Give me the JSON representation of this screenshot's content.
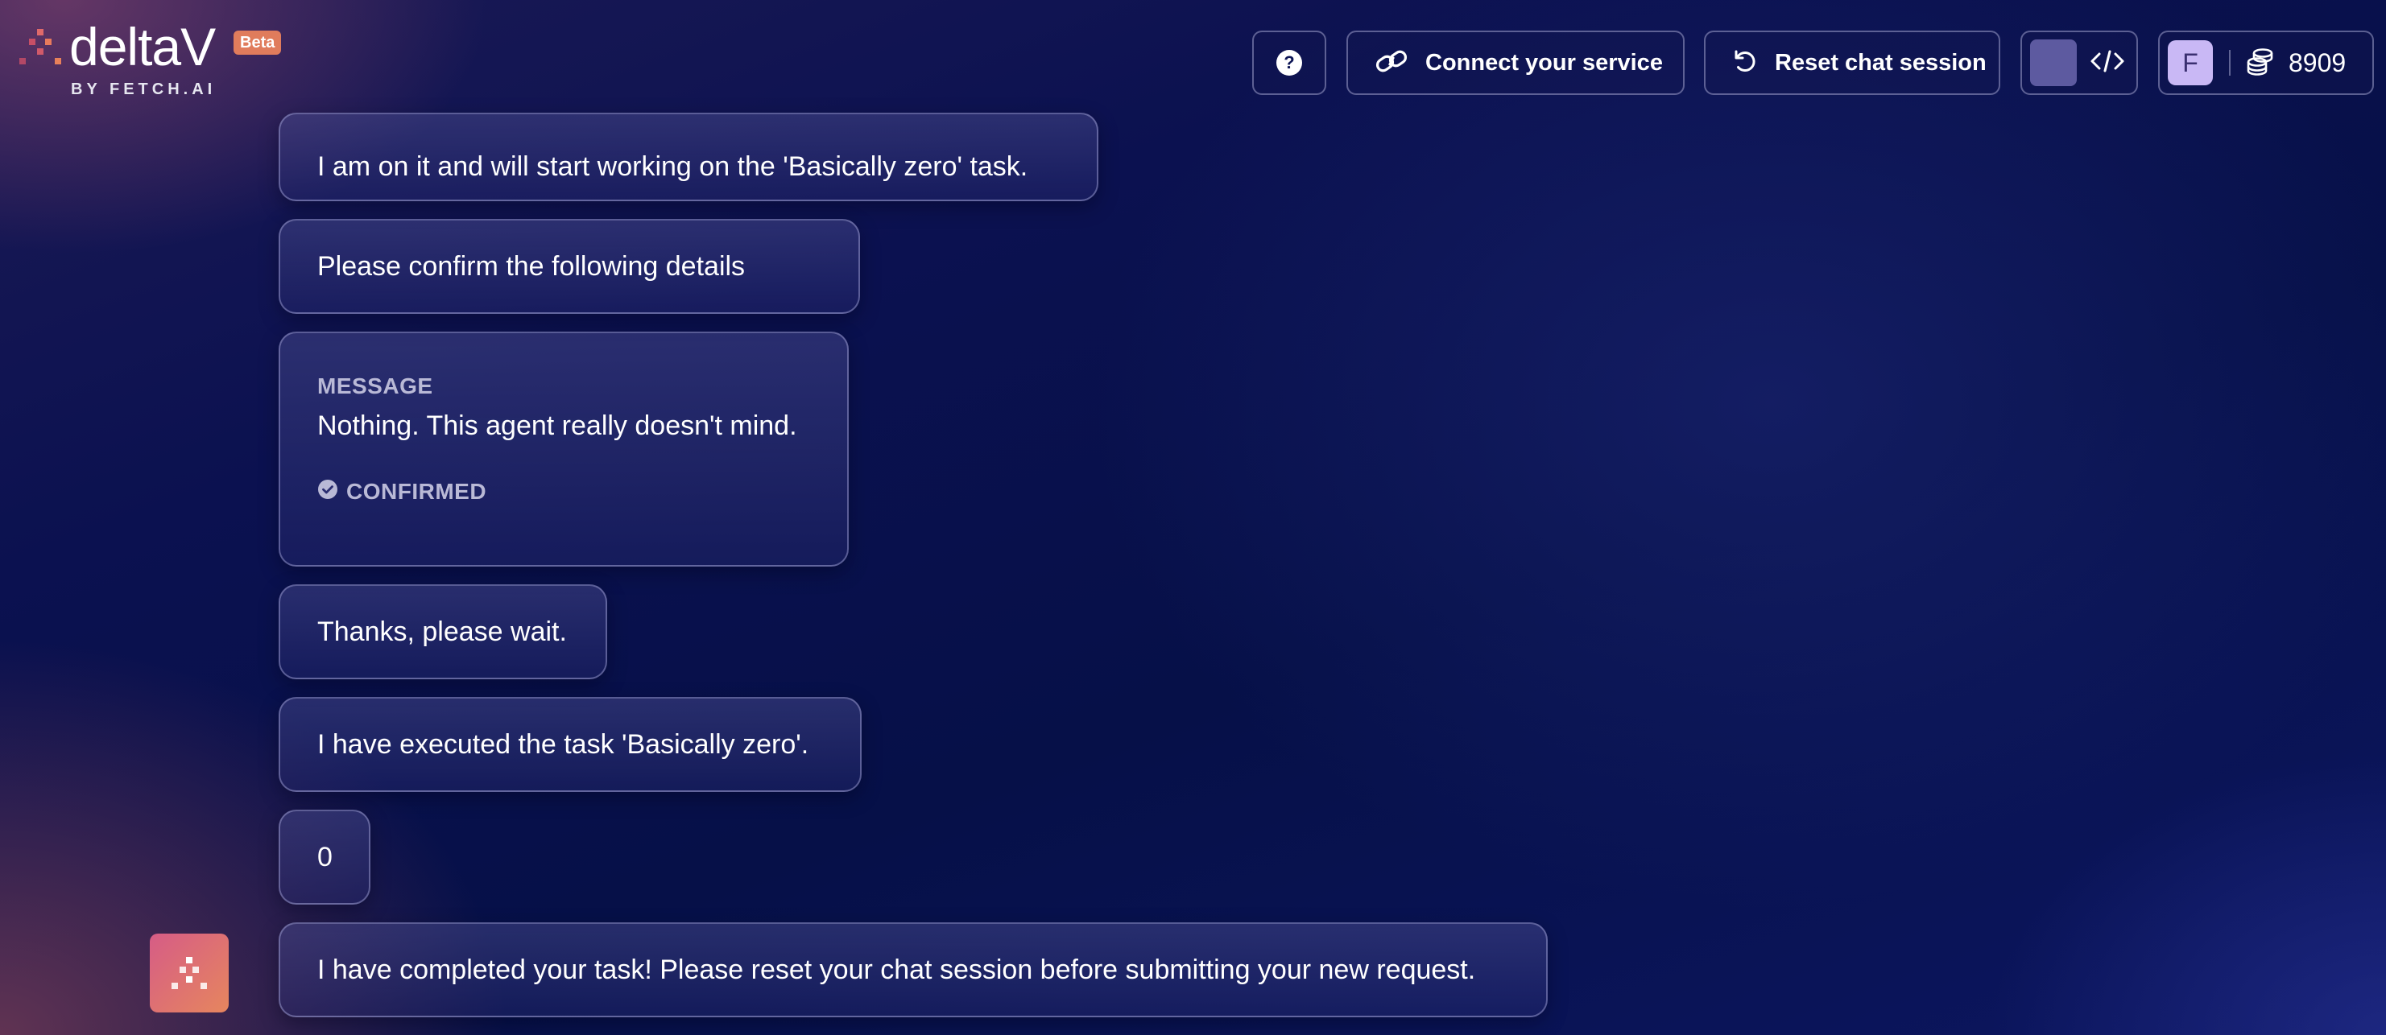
{
  "app": {
    "brand": "deltaV",
    "byline": "BY FETCH.AI",
    "beta_badge": "Beta"
  },
  "header": {
    "help_symbol": "?",
    "connect_label": "Connect your service",
    "reset_label": "Reset chat session",
    "user_initial": "F",
    "credits": "8909"
  },
  "icons": {
    "help": "question-circle-icon",
    "connect": "link-icon",
    "reset": "rotate-ccw-icon",
    "code": "code-brackets-icon",
    "credits": "coins-stack-icon",
    "confirmed": "check-circle-icon"
  },
  "colors": {
    "beta_badge": "#e07c5c",
    "avatar_bg": "#c9b8f5",
    "swatch": "#5d5aa0",
    "agent_gradient_start": "#d65c86",
    "agent_gradient_end": "#e6865e"
  },
  "chat": {
    "messages": [
      {
        "text": "I am on it and will start working on the 'Basically zero' task."
      },
      {
        "text": "Please confirm the following details"
      },
      {
        "detail_heading": "MESSAGE",
        "detail_body": "Nothing. This agent really doesn't mind.",
        "status": "CONFIRMED"
      },
      {
        "text": "Thanks, please wait."
      },
      {
        "text": "I have executed the task 'Basically zero'."
      },
      {
        "text": "0"
      },
      {
        "text": "I have completed your task! Please reset your chat session before submitting your new request."
      }
    ]
  }
}
